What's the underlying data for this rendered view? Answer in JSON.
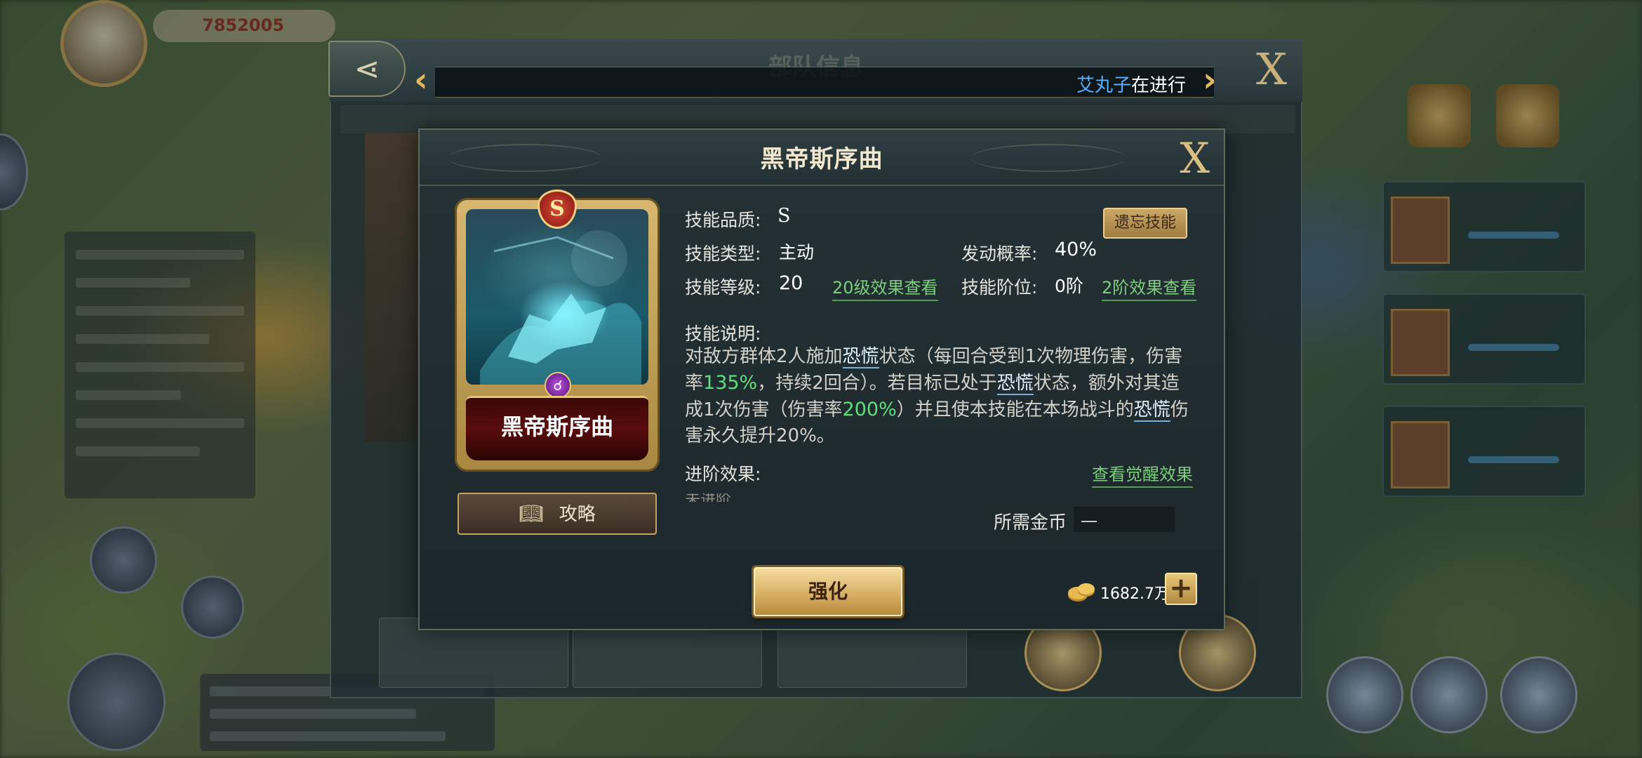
{
  "hud": {
    "resource_value": "7852005"
  },
  "back_panel": {
    "title": "部队信息",
    "marquee_name": "艾丸子",
    "marquee_text": "在进行"
  },
  "modal": {
    "title": "黑帝斯序曲",
    "close_label": "X",
    "card": {
      "grade_badge": "S",
      "name": "黑帝斯序曲"
    },
    "strategy_label": "攻略",
    "quality_label": "技能品质:",
    "quality_value": "S",
    "forget_label": "遗忘技能",
    "type_label": "技能类型:",
    "type_value": "主动",
    "chance_label": "发动概率:",
    "chance_value": "40%",
    "level_label": "技能等级:",
    "level_value": "20",
    "level_link": "20级效果查看",
    "stage_label": "技能阶位:",
    "stage_value": "0阶",
    "stage_link": "2阶效果查看",
    "desc_label": "技能说明:",
    "desc": {
      "p1": "对敌方群体2人施加",
      "kw1": "恐慌",
      "p2": "状态（每回合受到1次物理伤害，伤害率",
      "n1": "135%",
      "p3": "，持续2回合）。若目标已处于",
      "kw2": "恐慌",
      "p4": "状态，额外对其造成1次伤害（伤害率",
      "n2": "200%",
      "p5": "）并且使本技能在本场战斗的",
      "kw3": "恐慌",
      "p6": "伤害永久提升20%。"
    },
    "advance_label": "进阶效果:",
    "advance_cut_text": "未进阶",
    "awaken_link": "查看觉醒效果",
    "gold_label": "所需金币",
    "gold_value": "一",
    "enhance_label": "强化",
    "coin_amount": "1682.7万",
    "plus_label": "+"
  }
}
